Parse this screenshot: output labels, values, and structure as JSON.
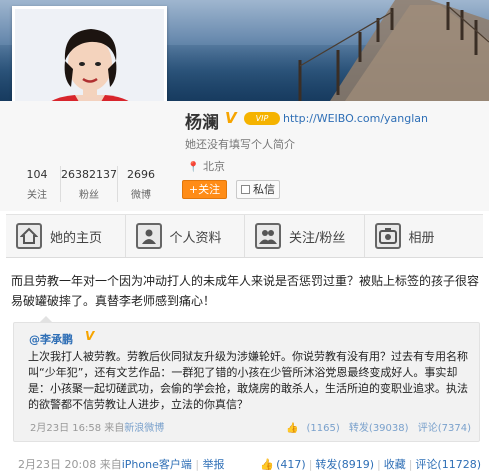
{
  "profile": {
    "name": "杨澜",
    "v_badge": "V",
    "vip_badge": "VIP",
    "url": "http://WEIBO.com/yanglan",
    "intro": "她还没有填写个人简介",
    "location": "北京",
    "follow_label": "+关注",
    "message_label": "私信"
  },
  "stats": [
    {
      "num": "104",
      "label": "关注"
    },
    {
      "num": "26382137",
      "label": "粉丝"
    },
    {
      "num": "2696",
      "label": "微博"
    }
  ],
  "tabs": [
    {
      "label": "她的主页",
      "icon": "home-icon"
    },
    {
      "label": "个人资料",
      "icon": "profile-icon"
    },
    {
      "label": "关注/粉丝",
      "icon": "follow-icon"
    },
    {
      "label": "相册",
      "icon": "camera-icon"
    }
  ],
  "post": {
    "text": "而且劳教一年对一个因为冲动打人的未成年人来说是否惩罚过重？被贴上标签的孩子很容易破罐破摔了。真替李老师感到痛心！",
    "date": "2月23日 20:08",
    "source_prefix": "来自",
    "source": "iPhone客户端",
    "report": "举报",
    "likes": "(417)",
    "repost": "转发(8919)",
    "favorite": "收藏",
    "comment": "评论(11728)"
  },
  "quoted": {
    "author": "@李承鹏",
    "v_badge": "V",
    "text": "上次我打人被劳教。劳教后伙同狱友升级为涉嫌轮奸。你说劳教有没有用？过去有专用名称叫“少年犯”，还有文艺作品：一群犯了错的小孩在少管所沐浴党恩最终变成好人。事实却是：小孩聚一起切磋武功，会偷的学会抢，敢烧房的敢杀人，生活所迫的变职业追求。执法的欲警都不信劳教让人进步，立法的你真信？",
    "date": "2月23日 16:58",
    "source_prefix": "来自",
    "source": "新浪微博",
    "likes": "(1165)",
    "repost": "转发(39038)",
    "comment": "评论(7374)"
  },
  "colors": {
    "accent": "#ff8c16",
    "link": "#2f6fb6",
    "badge": "#f5b300"
  }
}
